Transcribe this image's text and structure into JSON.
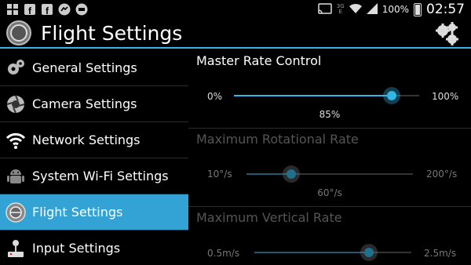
{
  "status_bar": {
    "left_icons": [
      "windows-icon",
      "facebook-icon",
      "facebook-icon",
      "messenger-icon",
      "app-icon"
    ],
    "network_label": "3G\nE",
    "battery": "100%",
    "time": "02:57"
  },
  "action_bar": {
    "title": "Flight Settings",
    "icon": "drone-icon",
    "menu_icon": "gears-icon"
  },
  "sidebar": {
    "items": [
      {
        "label": "General Settings",
        "icon": "gears-icon",
        "active": false
      },
      {
        "label": "Camera Settings",
        "icon": "camera-aperture-icon",
        "active": false
      },
      {
        "label": "Network Settings",
        "icon": "wifi-icon",
        "active": false
      },
      {
        "label": "System Wi-Fi Settings",
        "icon": "android-icon",
        "active": false
      },
      {
        "label": "Flight Settings",
        "icon": "drone-icon",
        "active": true
      },
      {
        "label": "Input Settings",
        "icon": "joystick-icon",
        "active": false
      }
    ]
  },
  "main": {
    "sections": [
      {
        "title": "Master Rate Control",
        "min_label": "0%",
        "max_label": "100%",
        "value_label": "85%",
        "enabled": true,
        "fraction": 0.85
      },
      {
        "title": "Maximum Rotational Rate",
        "min_label": "10°/s",
        "max_label": "200°/s",
        "value_label": "60°/s",
        "enabled": false,
        "fraction": 0.27
      },
      {
        "title": "Maximum Vertical Rate",
        "min_label": "0.5m/s",
        "max_label": "2.5m/s",
        "value_label": "",
        "enabled": false,
        "fraction": 0.73
      }
    ]
  },
  "colors": {
    "accent": "#33b5e5",
    "active_item": "#33a3d6"
  }
}
